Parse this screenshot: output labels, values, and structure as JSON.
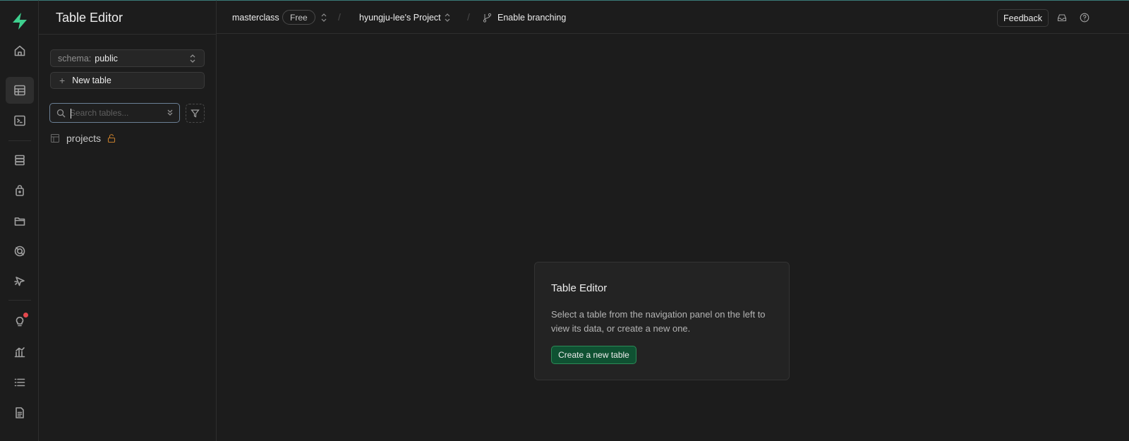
{
  "sidebar": {
    "title": "Table Editor",
    "schema_label": "schema:",
    "schema_value": "public",
    "new_table_label": "New table",
    "search_placeholder": "Search tables...",
    "search_value": "",
    "tables": [
      {
        "name": "projects",
        "locked": true
      }
    ]
  },
  "nav": {
    "icons": [
      "home-icon",
      "table-editor-icon",
      "sql-editor-icon",
      "database-icon",
      "auth-icon",
      "storage-icon",
      "realtime-icon",
      "edge-functions-icon",
      "advisors-icon",
      "reports-icon",
      "logs-icon",
      "api-docs-icon"
    ],
    "active": "table-editor-icon",
    "notification_color": "#e5484d"
  },
  "header": {
    "org": "masterclass",
    "plan": "Free",
    "project": "hyungju-lee's Project",
    "branching": "Enable branching",
    "separator": "/",
    "feedback_label": "Feedback"
  },
  "empty_state": {
    "title": "Table Editor",
    "body": "Select a table from the navigation panel on the left to view its data, or create a new one.",
    "button_label": "Create a new table"
  },
  "colors": {
    "background": "#1c1c1c",
    "brand": "#3ecf8e",
    "primary_button": "#0f5132",
    "lock": "#c27c2c",
    "search_focus": "#6b7f95"
  }
}
